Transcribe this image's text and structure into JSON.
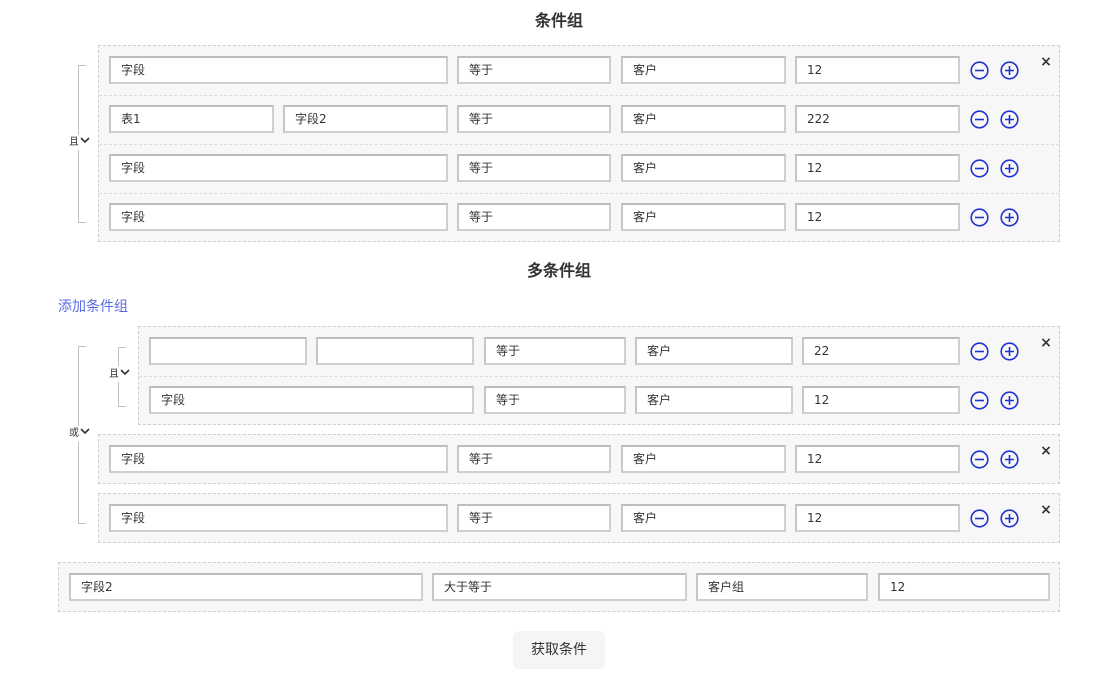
{
  "section1": {
    "title": "条件组",
    "logic": "且",
    "rows": [
      {
        "f1": "字段",
        "op": "等于",
        "type": "客户",
        "value": "12"
      },
      {
        "f1": "表1",
        "f2": "字段2",
        "op": "等于",
        "type": "客户",
        "value": "222"
      },
      {
        "f1": "字段",
        "op": "等于",
        "type": "客户",
        "value": "12"
      },
      {
        "f1": "字段",
        "op": "等于",
        "type": "客户",
        "value": "12"
      }
    ]
  },
  "section2": {
    "title": "多条件组",
    "add_group_label": "添加条件组",
    "outer_logic": "或",
    "inner_logic": "且",
    "inner_rows": [
      {
        "f1": "",
        "f2": "",
        "op": "等于",
        "type": "客户",
        "value": "22"
      },
      {
        "f1": "字段",
        "op": "等于",
        "type": "客户",
        "value": "12"
      }
    ],
    "groups": [
      {
        "f1": "字段",
        "op": "等于",
        "type": "客户",
        "value": "12"
      },
      {
        "f1": "字段",
        "op": "等于",
        "type": "客户",
        "value": "12"
      }
    ]
  },
  "single_condition": {
    "field": "字段2",
    "op": "大于等于",
    "type": "客户组",
    "value": "12"
  },
  "submit_label": "获取条件",
  "icons": {
    "remove": "minus-circle-icon",
    "add": "plus-circle-icon",
    "close": "close-icon",
    "dropdown": "chevron-down-icon"
  },
  "colors": {
    "accent": "#1d34d4",
    "link": "#5b6be6",
    "panel": "#f7f7f7"
  }
}
